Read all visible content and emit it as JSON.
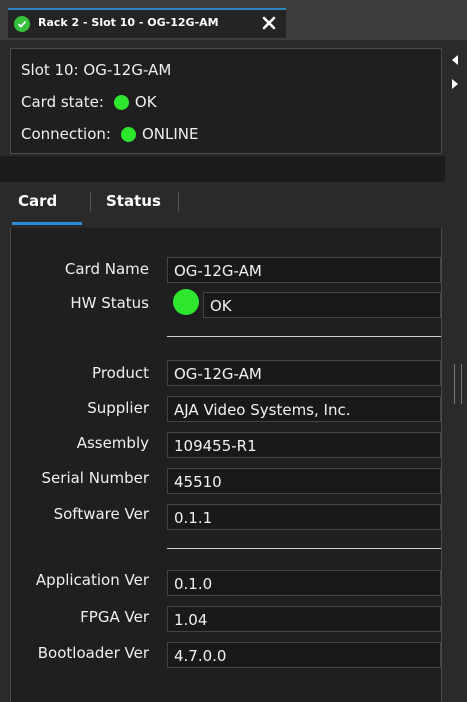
{
  "tabs": {
    "active_label": "Rack 2 - Slot 10 - OG-12G-AM",
    "status_icon": "check-icon",
    "status_color": "#34c13c",
    "close_icon": "close-icon"
  },
  "summary": {
    "slot": "Slot 10: OG-12G-AM",
    "card_state_label": "Card state:",
    "card_state_value": "OK",
    "connection_label": "Connection:",
    "connection_value": "ONLINE",
    "indicator_color": "#2ee62e"
  },
  "side_nav": [
    "chevron-left-icon",
    "chevron-right-icon"
  ],
  "subtabs": [
    {
      "label": "Card",
      "active": true
    },
    {
      "label": "Status",
      "active": false
    }
  ],
  "fields": {
    "card_name": {
      "label": "Card Name",
      "value": "OG-12G-AM"
    },
    "hw_status": {
      "label": "HW Status",
      "value": "OK"
    },
    "product": {
      "label": "Product",
      "value": "OG-12G-AM"
    },
    "supplier": {
      "label": "Supplier",
      "value": "AJA Video Systems, Inc."
    },
    "assembly": {
      "label": "Assembly",
      "value": "109455-R1"
    },
    "serial": {
      "label": "Serial Number",
      "value": "45510"
    },
    "software": {
      "label": "Software Ver",
      "value": "0.1.1"
    },
    "application": {
      "label": "Application Ver",
      "value": "0.1.0"
    },
    "fpga": {
      "label": "FPGA Ver",
      "value": "1.04"
    },
    "bootloader": {
      "label": "Bootloader Ver",
      "value": "4.7.0.0"
    }
  }
}
